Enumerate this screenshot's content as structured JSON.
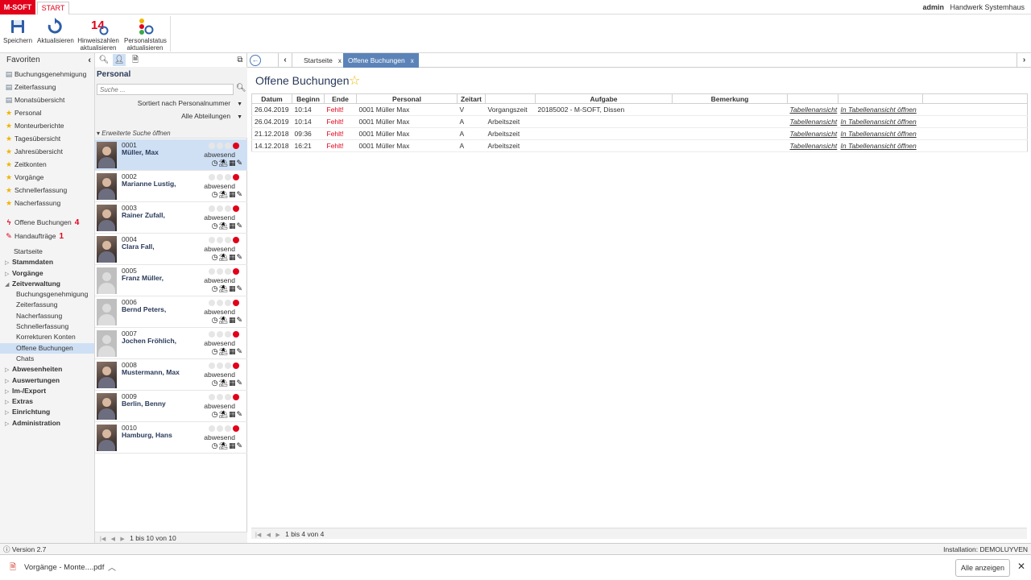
{
  "topbar": {
    "brand": "M-SOFT",
    "tab": "START",
    "user": "admin",
    "company": "Handwerk Systemhaus"
  },
  "ribbon": {
    "save": "Speichern",
    "refresh": "Aktualisieren",
    "hint_line1": "Hinweiszahlen",
    "hint_line2": "aktualisieren",
    "hint_badge": "14",
    "status_line1": "Personalstatus",
    "status_line2": "aktualisieren"
  },
  "sidebar": {
    "favorites_title": "Favoriten",
    "favorites": [
      {
        "label": "Buchungsgenehmigung",
        "icon": "document-icon"
      },
      {
        "label": "Zeiterfassung",
        "icon": "document-icon"
      },
      {
        "label": "Monatsübersicht",
        "icon": "document-icon"
      },
      {
        "label": "Personal",
        "icon": "star-icon"
      },
      {
        "label": "Monteurberichte",
        "icon": "star-icon"
      },
      {
        "label": "Tagesübersicht",
        "icon": "star-icon"
      },
      {
        "label": "Jahresübersicht",
        "icon": "star-icon"
      },
      {
        "label": "Zeitkonten",
        "icon": "star-icon"
      },
      {
        "label": "Vorgänge",
        "icon": "star-icon"
      },
      {
        "label": "Schnellerfassung",
        "icon": "star-icon"
      },
      {
        "label": "Nacherfassung",
        "icon": "star-icon"
      }
    ],
    "alerts": [
      {
        "label": "Offene Buchungen",
        "count": "4"
      },
      {
        "label": "Handaufträge",
        "count": "1"
      }
    ],
    "nav_root": "Startseite",
    "nav_groups_top": [
      "Stammdaten",
      "Vorgänge"
    ],
    "nav_open_group": "Zeitverwaltung",
    "nav_sub": [
      "Buchungsgenehmigung",
      "Zeiterfassung",
      "Nacherfassung",
      "Schnellerfassung",
      "Korrekturen Konten",
      "Offene Buchungen",
      "Chats"
    ],
    "nav_active": "Offene Buchungen",
    "nav_groups_bottom": [
      "Abwesenheiten",
      "Auswertungen",
      "Im-/Export",
      "Extras",
      "Einrichtung",
      "Administration"
    ]
  },
  "personal": {
    "title": "Personal",
    "search_placeholder": "Suche ...",
    "sort": "Sortiert nach Personalnummer",
    "department": "Alle Abteilungen",
    "extended_search": "Erweiterte Suche öffnen",
    "status_label": "abwesend",
    "people": [
      {
        "num": "0001",
        "name": "Müller, Max",
        "photo": true
      },
      {
        "num": "0002",
        "name": "Marianne Lustig,",
        "photo": true
      },
      {
        "num": "0003",
        "name": "Rainer Zufall,",
        "photo": true
      },
      {
        "num": "0004",
        "name": "Clara Fall,",
        "photo": true
      },
      {
        "num": "0005",
        "name": "Franz Müller,",
        "photo": false
      },
      {
        "num": "0006",
        "name": "Bernd Peters,",
        "photo": false
      },
      {
        "num": "0007",
        "name": "Jochen Fröhlich,",
        "photo": false
      },
      {
        "num": "0008",
        "name": "Mustermann, Max",
        "photo": true
      },
      {
        "num": "0009",
        "name": "Berlin, Benny",
        "photo": true
      },
      {
        "num": "0010",
        "name": "Hamburg, Hans",
        "photo": true
      }
    ],
    "footer": "1 bis 10 von 10"
  },
  "main": {
    "tabs": [
      {
        "label": "Startseite",
        "close": "x",
        "active": false
      },
      {
        "label": "Offene Buchungen",
        "close": "x",
        "active": true
      }
    ],
    "title": "Offene Buchungen",
    "columns": [
      "Datum",
      "Beginn",
      "Ende",
      "Personal",
      "Zeitart",
      "",
      "Aufgabe",
      "Bemerkung",
      "",
      "",
      ""
    ],
    "rows": [
      {
        "datum": "26.04.2019",
        "beginn": "10:14",
        "ende": "Fehlt!",
        "personal": "0001 Müller Max",
        "zeitart": "V",
        "typ": "Vorgangszeit",
        "aufgabe": "20185002 - M-SOFT, Dissen",
        "bemerkung": "",
        "link1": "Tabellenansicht",
        "link2": "In Tabellenansicht öffnen"
      },
      {
        "datum": "26.04.2019",
        "beginn": "10:14",
        "ende": "Fehlt!",
        "personal": "0001 Müller Max",
        "zeitart": "A",
        "typ": "Arbeitszeit",
        "aufgabe": "",
        "bemerkung": "",
        "link1": "Tabellenansicht",
        "link2": "In Tabellenansicht öffnen"
      },
      {
        "datum": "21.12.2018",
        "beginn": "09:36",
        "ende": "Fehlt!",
        "personal": "0001 Müller Max",
        "zeitart": "A",
        "typ": "Arbeitszeit",
        "aufgabe": "",
        "bemerkung": "",
        "link1": "Tabellenansicht",
        "link2": "In Tabellenansicht öffnen"
      },
      {
        "datum": "14.12.2018",
        "beginn": "16:21",
        "ende": "Fehlt!",
        "personal": "0001 Müller Max",
        "zeitart": "A",
        "typ": "Arbeitszeit",
        "aufgabe": "",
        "bemerkung": "",
        "link1": "Tabellenansicht",
        "link2": "In Tabellenansicht öffnen"
      }
    ],
    "footer": "1 bis 4 von 4"
  },
  "statusbar": {
    "version": "Version 2.7",
    "installation": "Installation: DEMOLUYVEN"
  },
  "downloads": {
    "file": "Vorgänge - Monte....pdf",
    "show_all": "Alle anzeigen"
  },
  "colors": {
    "brand": "#e2001a",
    "accent": "#5b83b8",
    "selection": "#cfe0f5",
    "star": "#f0b400"
  }
}
